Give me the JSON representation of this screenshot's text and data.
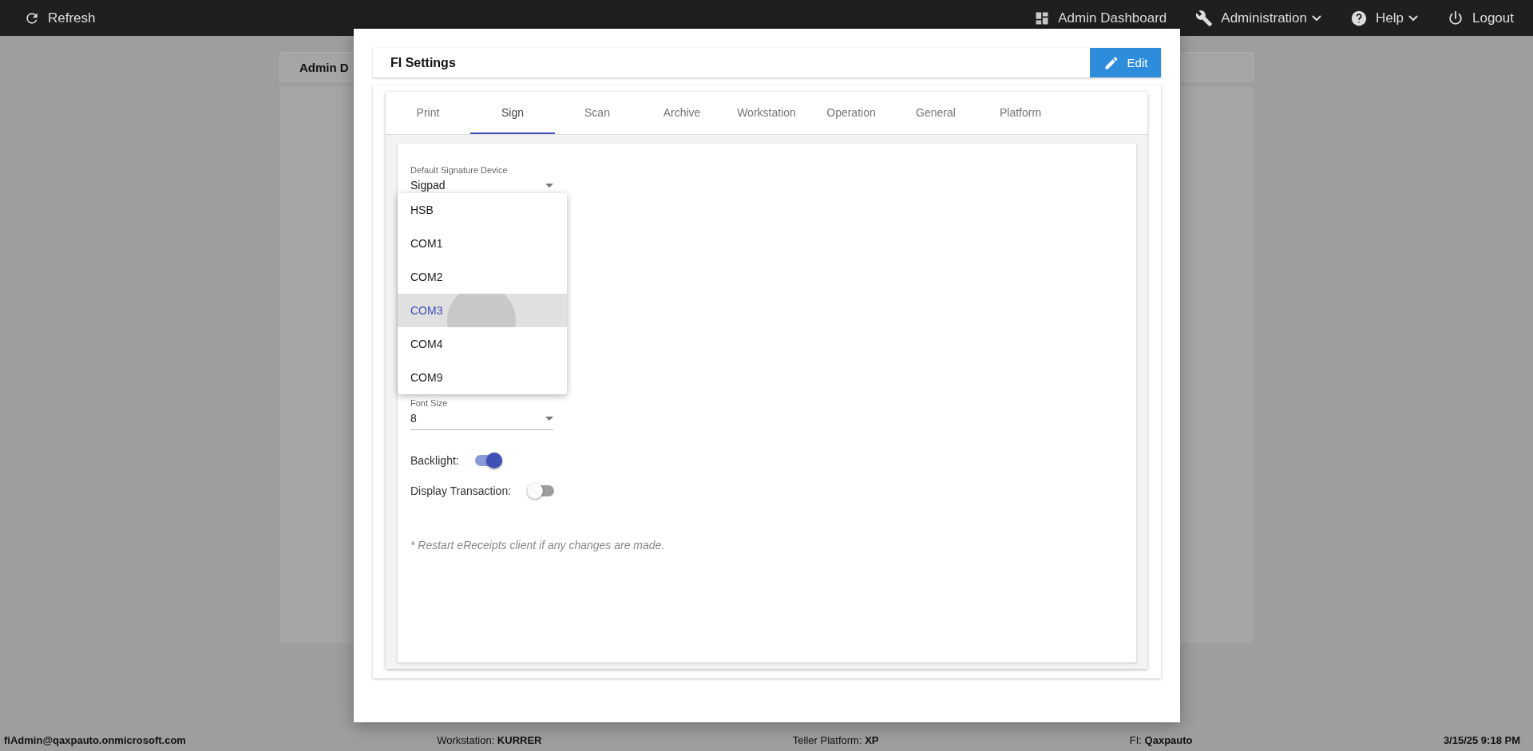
{
  "top_bar": {
    "refresh": "Refresh",
    "items": [
      {
        "kind": "dashboard",
        "label": "Admin Dashboard",
        "caret": false
      },
      {
        "kind": "wrench",
        "label": "Administration",
        "caret": true
      },
      {
        "kind": "help",
        "label": "Help",
        "caret": true
      },
      {
        "kind": "power",
        "label": "Logout",
        "caret": false
      }
    ]
  },
  "background": {
    "card_title": "Admin D"
  },
  "dialog": {
    "title": "FI Settings",
    "edit_button": "Edit",
    "tabs": [
      {
        "label": "Print",
        "selected": false
      },
      {
        "label": "Sign",
        "selected": true
      },
      {
        "label": "Scan",
        "selected": false
      },
      {
        "label": "Archive",
        "selected": false
      },
      {
        "label": "Workstation",
        "selected": false
      },
      {
        "label": "Operation",
        "selected": false
      },
      {
        "label": "General",
        "selected": false
      },
      {
        "label": "Platform",
        "selected": false
      }
    ],
    "signature_device": {
      "label": "Default Signature Device",
      "value": "Sigpad"
    },
    "menu": [
      {
        "label": "HSB",
        "selected": false
      },
      {
        "label": "COM1",
        "selected": false
      },
      {
        "label": "COM2",
        "selected": false
      },
      {
        "label": "COM3",
        "selected": true
      },
      {
        "label": "COM4",
        "selected": false
      },
      {
        "label": "COM9",
        "selected": false
      }
    ],
    "font_size": {
      "label": "Font Size",
      "value": "8"
    },
    "toggles": [
      {
        "label": "Backlight:",
        "on": true
      },
      {
        "label": "Display Transaction:",
        "on": false
      }
    ],
    "note": "* Restart eReceipts client if any changes are made."
  },
  "status_bar": {
    "user": "fiAdmin@qaxpauto.onmicrosoft.com",
    "fields": [
      {
        "label": "Workstation:",
        "value": "KURRER"
      },
      {
        "label": "Teller Platform:",
        "value": "XP"
      },
      {
        "label": "FI:",
        "value": "Qaxpauto"
      }
    ],
    "datetime": "3/15/25 9:18 PM"
  }
}
